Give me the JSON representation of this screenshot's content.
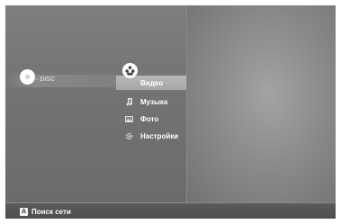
{
  "source": {
    "label": "DISC",
    "icon": "disc-icon"
  },
  "menu": {
    "items": [
      {
        "label": "Видео",
        "icon": "film-reel-icon",
        "selected": true
      },
      {
        "label": "Музыка",
        "icon": "music-icon",
        "selected": false
      },
      {
        "label": "Фото",
        "icon": "photo-icon",
        "selected": false
      },
      {
        "label": "Настройки",
        "icon": "settings-icon",
        "selected": false
      }
    ]
  },
  "footer": {
    "key": "A",
    "label": "Поиск сети"
  },
  "colors": {
    "background": "#6f6f6f",
    "highlight": "#b0b0b0",
    "text": "#ffffff"
  }
}
